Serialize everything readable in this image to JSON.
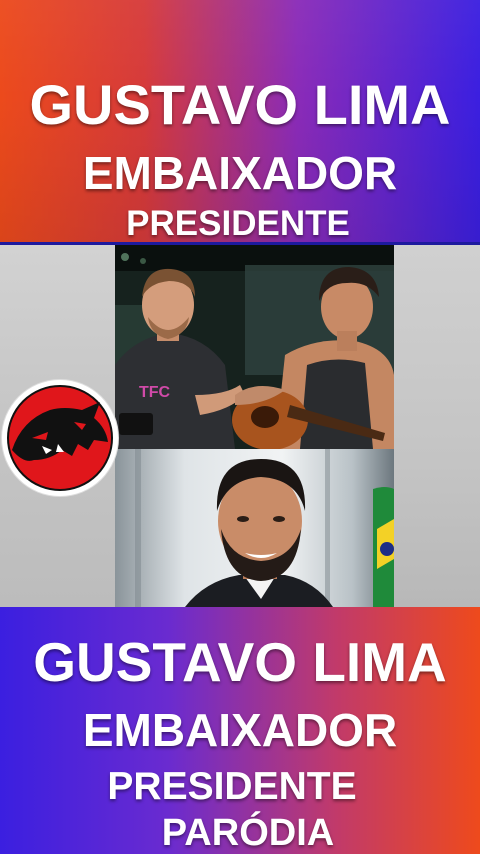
{
  "top_banner": {
    "line1": "GUSTAVO LIMA",
    "line2": "EMBAIXADOR",
    "line3": "PRESIDENTE"
  },
  "videos": {
    "clip1_shirt_text": "TFC"
  },
  "bottom_banner": {
    "line1": "GUSTAVO LIMA",
    "line2": "EMBAIXADOR",
    "line3": "PRESIDENTE",
    "line4": "PARÓDIA"
  },
  "colors": {
    "top_gradient": [
      "#ec4a1c",
      "#3b1fe0"
    ],
    "bottom_gradient": [
      "#3b1fe0",
      "#ee4a1c"
    ],
    "logo_red": "#e0161b",
    "text": "#ffffff"
  },
  "icons": {
    "logo": "thundercats-logo"
  }
}
